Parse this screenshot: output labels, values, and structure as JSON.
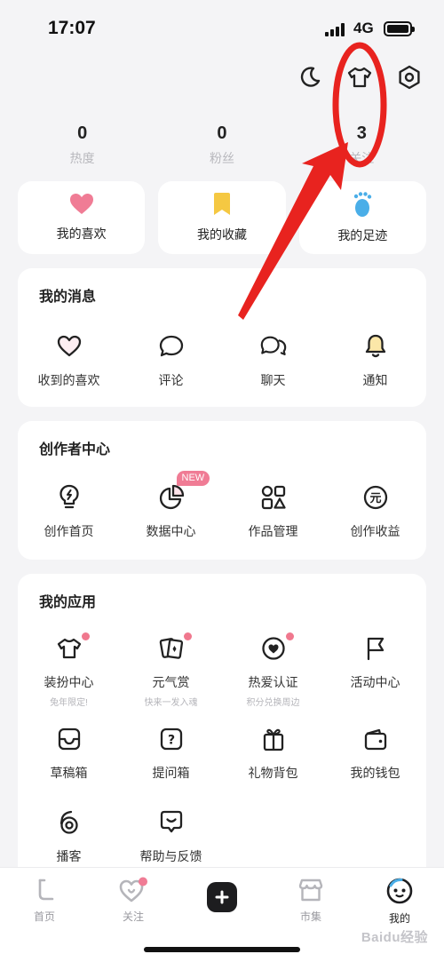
{
  "status_bar": {
    "time": "17:07",
    "network": "4G"
  },
  "top_icons": [
    "moon-icon",
    "tshirt-icon",
    "settings-icon"
  ],
  "stats": [
    {
      "value": "0",
      "label": "热度"
    },
    {
      "value": "0",
      "label": "粉丝"
    },
    {
      "value": "3",
      "label": "关注"
    }
  ],
  "quick_cards": [
    {
      "label": "我的喜欢",
      "icon": "heart-icon",
      "color": "#f07c95"
    },
    {
      "label": "我的收藏",
      "icon": "bookmark-icon",
      "color": "#f5c842"
    },
    {
      "label": "我的足迹",
      "icon": "footprint-icon",
      "color": "#4aaee8"
    }
  ],
  "messages": {
    "title": "我的消息",
    "items": [
      {
        "label": "收到的喜欢",
        "icon": "heart-outline-icon"
      },
      {
        "label": "评论",
        "icon": "comment-icon"
      },
      {
        "label": "聊天",
        "icon": "chat-icon"
      },
      {
        "label": "通知",
        "icon": "bell-icon"
      }
    ]
  },
  "creator": {
    "title": "创作者中心",
    "new_badge": "NEW",
    "items": [
      {
        "label": "创作首页",
        "icon": "lightbulb-icon"
      },
      {
        "label": "数据中心",
        "icon": "pie-chart-icon"
      },
      {
        "label": "作品管理",
        "icon": "shapes-icon"
      },
      {
        "label": "创作收益",
        "icon": "yuan-coin-icon",
        "glyph": "元"
      }
    ]
  },
  "apps": {
    "title": "我的应用",
    "items": [
      {
        "label": "装扮中心",
        "sub": "兔年限定!",
        "icon": "tshirt-icon",
        "dot": true
      },
      {
        "label": "元气赏",
        "sub": "快来一发入魂",
        "icon": "cards-icon",
        "dot": true
      },
      {
        "label": "热爱认证",
        "sub": "积分兑换周边",
        "icon": "badge-heart-icon",
        "dot": true
      },
      {
        "label": "活动中心",
        "sub": "",
        "icon": "flag-icon",
        "dot": false
      },
      {
        "label": "草稿箱",
        "sub": "",
        "icon": "inbox-icon",
        "dot": false
      },
      {
        "label": "提问箱",
        "sub": "",
        "icon": "question-box-icon",
        "dot": false
      },
      {
        "label": "礼物背包",
        "sub": "",
        "icon": "gift-icon",
        "dot": false
      },
      {
        "label": "我的钱包",
        "sub": "",
        "icon": "wallet-icon",
        "dot": false
      },
      {
        "label": "播客",
        "sub": "",
        "icon": "podcast-icon",
        "dot": false
      },
      {
        "label": "帮助与反馈",
        "sub": "",
        "icon": "help-chat-icon",
        "dot": false
      }
    ]
  },
  "tabbar": [
    {
      "label": "首页",
      "icon": "home-icon",
      "active": false
    },
    {
      "label": "关注",
      "icon": "follow-heart-icon",
      "active": false
    },
    {
      "label": "",
      "icon": "plus-icon",
      "active": false
    },
    {
      "label": "市集",
      "icon": "store-icon",
      "active": false
    },
    {
      "label": "我的",
      "icon": "profile-face-icon",
      "active": true
    }
  ],
  "watermark": "Baidu经验",
  "colors": {
    "accent": "#f07c95",
    "annotation": "#e8231f"
  }
}
